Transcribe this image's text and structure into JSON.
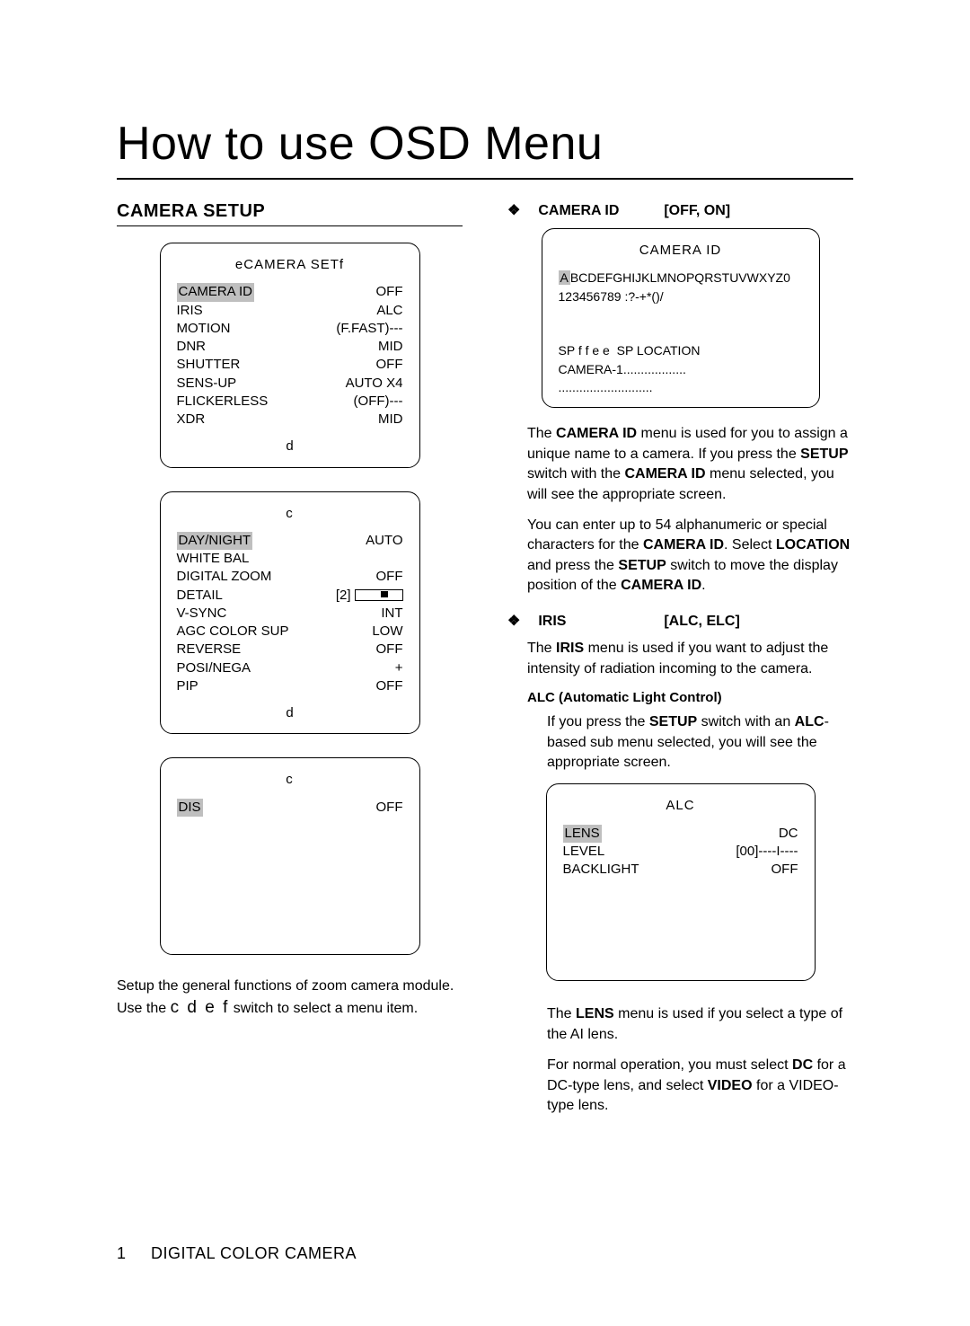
{
  "page_title": "How to use OSD Menu",
  "footer": {
    "page_num": "1",
    "label": "DIGITAL COLOR CAMERA"
  },
  "left": {
    "section_title": "CAMERA SETUP",
    "box1": {
      "title": "eCAMERA SETf",
      "rows": [
        {
          "l": "CAMERA ID",
          "r": "OFF",
          "hl": true
        },
        {
          "l": "IRIS",
          "r": "ALC"
        },
        {
          "l": "MOTION",
          "r": "(F.FAST)---"
        },
        {
          "l": "DNR",
          "r": "MID"
        },
        {
          "l": "SHUTTER",
          "r": "OFF"
        },
        {
          "l": "SENS-UP",
          "r": "AUTO X4"
        },
        {
          "l": "FLICKERLESS",
          "r": "(OFF)---"
        },
        {
          "l": "XDR",
          "r": "MID"
        }
      ],
      "foot": "d"
    },
    "box2": {
      "title": "c",
      "rows": [
        {
          "l": "DAY/NIGHT",
          "r": "AUTO",
          "hl": true
        },
        {
          "l": "WHITE BAL",
          "r": ""
        },
        {
          "l": "DIGITAL ZOOM",
          "r": "OFF"
        },
        {
          "l": "DETAIL",
          "r": "[2]",
          "slider": true
        },
        {
          "l": "V-SYNC",
          "r": "INT"
        },
        {
          "l": "AGC COLOR SUP",
          "r": "LOW"
        },
        {
          "l": "REVERSE",
          "r": "OFF"
        },
        {
          "l": "POSI/NEGA",
          "r": "+"
        },
        {
          "l": "PIP",
          "r": "OFF"
        }
      ],
      "foot": "d"
    },
    "box3": {
      "title": "c",
      "rows": [
        {
          "l": "DIS",
          "r": "OFF",
          "hl": true
        }
      ]
    },
    "note1": "Setup the general functions of zoom camera module.",
    "note2_a": "Use the ",
    "note2_kbd": "c d e f",
    "note2_b": " switch to select a menu item."
  },
  "right": {
    "cam_id": {
      "bullet": "❖",
      "name": "CAMERA ID",
      "opts": "[OFF, ON]",
      "box_title": "CAMERA ID",
      "box_line1_hl": "A",
      "box_line1_rest": "BCDEFGHIJKLMNOPQRSTUVWXYZ0",
      "box_line2": "123456789 :?-+*()/",
      "box_line3": "SP f f e e  SP LOCATION",
      "box_line4": "CAMERA-1..................",
      "box_line5": "...........................",
      "p1_a": "The ",
      "p1_b": "CAMERA ID",
      "p1_c": " menu is used for you to assign a unique name to a camera. If you press the ",
      "p1_d": "SETUP",
      "p1_e": " switch with the ",
      "p1_f": "CAMERA ID",
      "p1_g": " menu selected, you will see the appropriate screen.",
      "p2_a": "You can enter up to 54 alphanumeric or special characters for the ",
      "p2_b": "CAMERA ID",
      "p2_c": ". Select ",
      "p2_d": "LOCATION",
      "p2_e": " and press the ",
      "p2_f": "SETUP",
      "p2_g": " switch to move the display position of the ",
      "p2_h": "CAMERA ID",
      "p2_i": "."
    },
    "iris": {
      "bullet": "❖",
      "name": "IRIS",
      "opts": "[ALC, ELC]",
      "p1_a": "The ",
      "p1_b": "IRIS",
      "p1_c": " menu is used if you want to adjust the intensity of radiation incoming to the camera.",
      "sub_head": "ALC (Automatic Light Control)",
      "p2_a": "If you press the ",
      "p2_b": "SETUP",
      "p2_c": " switch with an ",
      "p2_d": "ALC",
      "p2_e": "-based sub menu selected, you will see the appropriate screen.",
      "box_title": "ALC",
      "rows": [
        {
          "l": "LENS",
          "r": "DC",
          "hl": true
        },
        {
          "l": "LEVEL",
          "r": "[00]----I----"
        },
        {
          "l": "BACKLIGHT",
          "r": "OFF"
        }
      ],
      "p3_a": "The ",
      "p3_b": "LENS",
      "p3_c": " menu is used if you select a type of the AI lens.",
      "p4_a": "For normal operation, you must select ",
      "p4_b": "DC",
      "p4_c": " for a DC-type lens, and select ",
      "p4_d": "VIDEO",
      "p4_e": " for a VIDEO-type lens."
    }
  }
}
